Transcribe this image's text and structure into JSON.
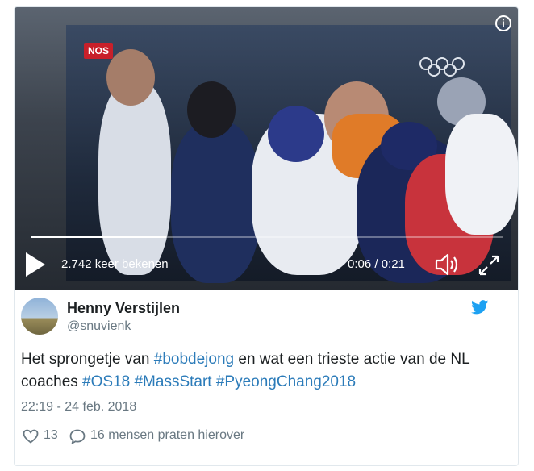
{
  "colors": {
    "link": "#2b7bb9",
    "twitter_blue": "#1da1f2",
    "muted": "#697882",
    "text": "#1c2022"
  },
  "media": {
    "type": "video",
    "channel_logo": "NOS",
    "views": "2.742 keer bekenen",
    "time": "0:06 / 0:21",
    "progress": 0.286,
    "icons": {
      "info": "info-icon",
      "play": "play-icon",
      "volume": "volume-icon",
      "fullscreen": "fullscreen-icon"
    }
  },
  "author": {
    "name": "Henny Verstijlen",
    "handle": "@snuvienk",
    "avatar": "avatar"
  },
  "tweet": {
    "part1": "Het sprongetje van ",
    "hashtag1": "#bobdejong",
    "part2": " en wat een trieste actie van de NL coaches ",
    "hashtag2": "#OS18",
    "hashtag3": "#MassStart",
    "hashtag4": "#PyeongChang2018",
    "date": "22:19 - 24 feb. 2018"
  },
  "actions": {
    "likes": "13",
    "replies": "16 mensen praten hierover"
  }
}
